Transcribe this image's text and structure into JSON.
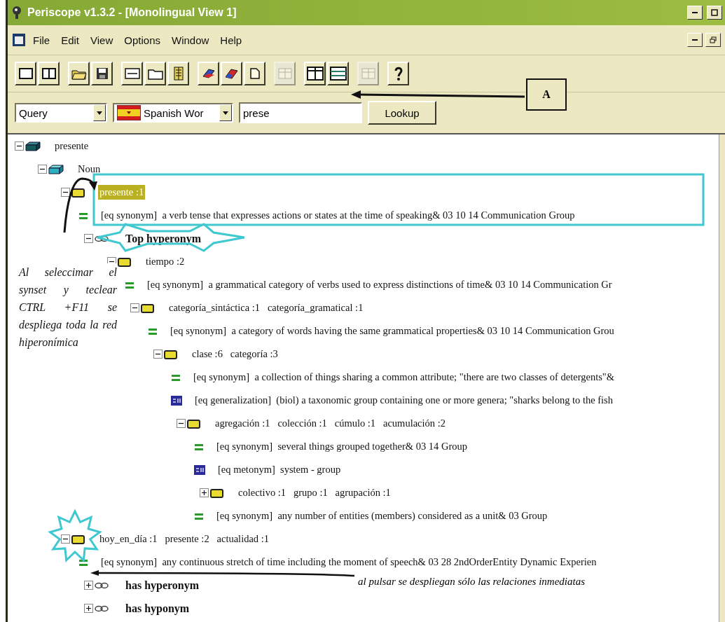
{
  "window": {
    "title": "Periscope v1.3.2 - [Monolingual View 1]"
  },
  "menu": [
    "File",
    "Edit",
    "View",
    "Options",
    "Window",
    "Help"
  ],
  "toolbar": {
    "groups": [
      {
        "buttons": [
          {
            "disabled": false
          },
          {
            "disabled": false
          }
        ]
      },
      {
        "buttons": [
          {
            "disabled": false
          },
          {
            "disabled": false
          }
        ]
      },
      {
        "buttons": [
          {
            "disabled": false
          },
          {
            "disabled": false
          },
          {
            "disabled": false
          }
        ]
      },
      {
        "buttons": [
          {
            "disabled": false
          },
          {
            "disabled": false
          },
          {
            "disabled": false
          }
        ]
      },
      {
        "buttons": [
          {
            "disabled": true
          }
        ]
      },
      {
        "buttons": [
          {
            "disabled": false
          },
          {
            "disabled": false
          }
        ]
      },
      {
        "buttons": [
          {
            "disabled": true
          }
        ]
      },
      {
        "buttons": [
          {
            "disabled": false
          }
        ]
      }
    ]
  },
  "query_bar": {
    "mode": "Query",
    "language": "Spanish Wor",
    "search": "prese",
    "button": "Lookup"
  },
  "callout": {
    "label": "A"
  },
  "tree": {
    "nodes": [
      {
        "kind": "word",
        "label": "presente",
        "expanded": true,
        "children": [
          {
            "kind": "pos",
            "label": "Noun",
            "expanded": true,
            "children": [
              {
                "kind": "synset",
                "label": "presente :1",
                "expanded": true,
                "selected": true,
                "children": [
                  {
                    "kind": "equal",
                    "label": "[eq synonym]  a verb tense that expresses actions or states at the time of speaking& 03 10 14 Communication Group"
                  },
                  {
                    "kind": "relation",
                    "label": "Top hyperonym",
                    "expanded": true,
                    "children": [
                      {
                        "kind": "synset",
                        "label": "tiempo :2",
                        "expanded": true,
                        "selected": false,
                        "children": [
                          {
                            "kind": "equal",
                            "label": "[eq synonym]  a grammatical category of verbs used to express distinctions of time& 03 10 14 Communication Gr"
                          },
                          {
                            "kind": "synset",
                            "label": "categoría_sintáctica :1   categoría_gramatical :1",
                            "expanded": true,
                            "selected": false,
                            "children": [
                              {
                                "kind": "equal",
                                "label": "[eq synonym]  a category of words having the same grammatical properties& 03 10 14 Communication Grou"
                              },
                              {
                                "kind": "synset",
                                "label": "clase :6   categoría :3",
                                "expanded": true,
                                "selected": false,
                                "children": [
                                  {
                                    "kind": "equal",
                                    "label": "[eq synonym]  a collection of things sharing a common attribute; \"there are two classes of detergents\"&"
                                  },
                                  {
                                    "kind": "eq_link",
                                    "label": "[eq generalization]  (biol) a taxonomic group containing one or more genera; \"sharks belong to the fish"
                                  },
                                  {
                                    "kind": "synset",
                                    "label": "agregación :1   colección :1   cúmulo :1   acumulación :2",
                                    "expanded": true,
                                    "selected": false,
                                    "children": [
                                      {
                                        "kind": "equal",
                                        "label": "[eq synonym]  several things grouped together& 03 14 Group"
                                      },
                                      {
                                        "kind": "eq_link",
                                        "label": "[eq metonym]  system - group"
                                      },
                                      {
                                        "kind": "synset",
                                        "label": "colectivo :1   grupo :1   agrupación :1",
                                        "expanded": false,
                                        "selected": false
                                      },
                                      {
                                        "kind": "equal",
                                        "label": "[eq synonym]  any number of entities (members) considered as a unit& 03 Group"
                                      }
                                    ]
                                  }
                                ]
                              }
                            ]
                          }
                        ]
                      }
                    ]
                  }
                ]
              },
              {
                "kind": "synset",
                "label": "hoy_en_día :1   presente :2   actualidad :1",
                "expanded": true,
                "selected": false,
                "children": [
                  {
                    "kind": "equal",
                    "label": "[eq synonym]  any continuous stretch of time including the moment of speech& 03 28 2ndOrderEntity Dynamic Experien"
                  },
                  {
                    "kind": "relation",
                    "label": "has hyperonym",
                    "expanded": false
                  },
                  {
                    "kind": "relation",
                    "label": "has hyponym",
                    "expanded": false
                  }
                ]
              }
            ]
          }
        ]
      }
    ]
  },
  "notes": {
    "left": "Al seleccimar el synset y teclear CTRL +F11 se despliega toda la red hiperonímica",
    "bottom": "al pulsar se despliegan sólo las relaciones inmediatas"
  }
}
